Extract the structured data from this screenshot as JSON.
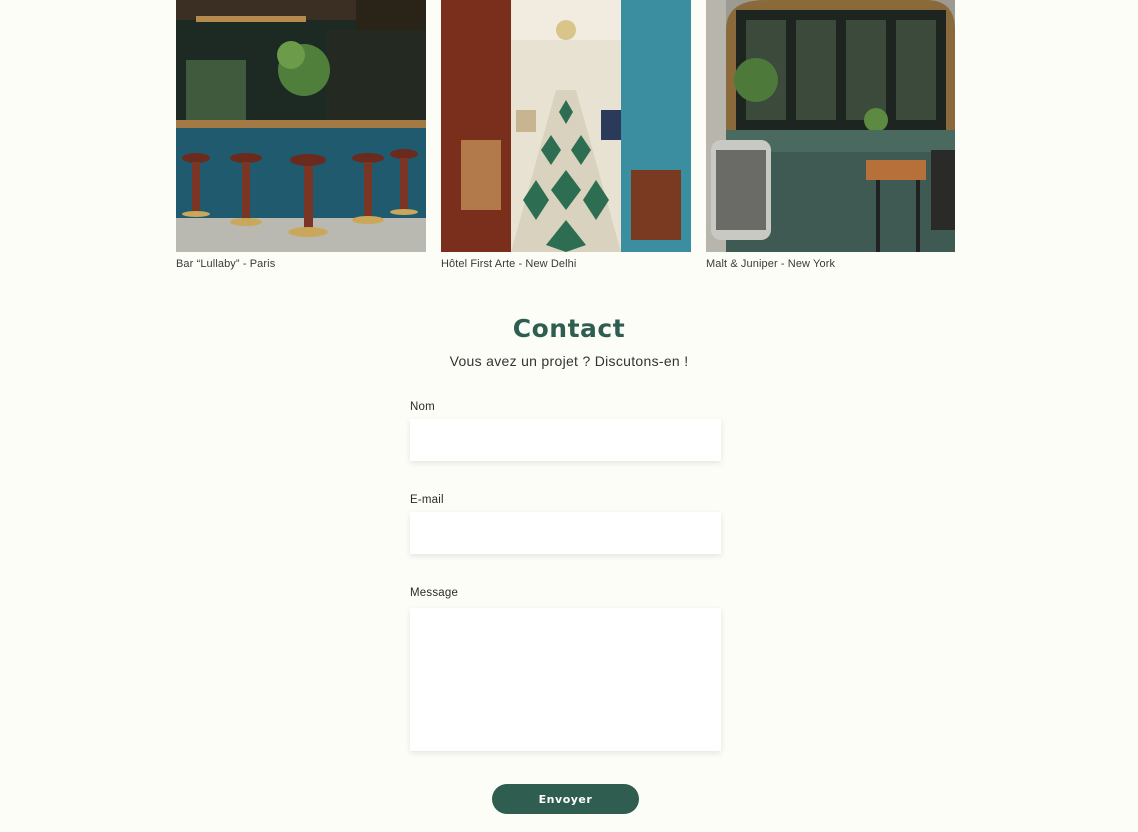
{
  "gallery": {
    "items": [
      {
        "caption": "Bar “Lullaby” - Paris",
        "photo": "bar-interior-photo"
      },
      {
        "caption": "Hôtel First Arte - New Delhi",
        "photo": "hotel-dining-hall-photo"
      },
      {
        "caption": "Malt & Juniper - New York",
        "photo": "bar-terrace-photo"
      }
    ]
  },
  "contact": {
    "title": "Contact",
    "subtitle": "Vous avez un projet ? Discutons-en !",
    "fields": {
      "name_label": "Nom",
      "name_value": "",
      "email_label": "E-mail",
      "email_value": "",
      "message_label": "Message",
      "message_value": ""
    },
    "submit_label": "Envoyer"
  },
  "colors": {
    "background": "#fdfdf8",
    "accent": "#2f5e51",
    "field_bg": "#ffffff"
  }
}
